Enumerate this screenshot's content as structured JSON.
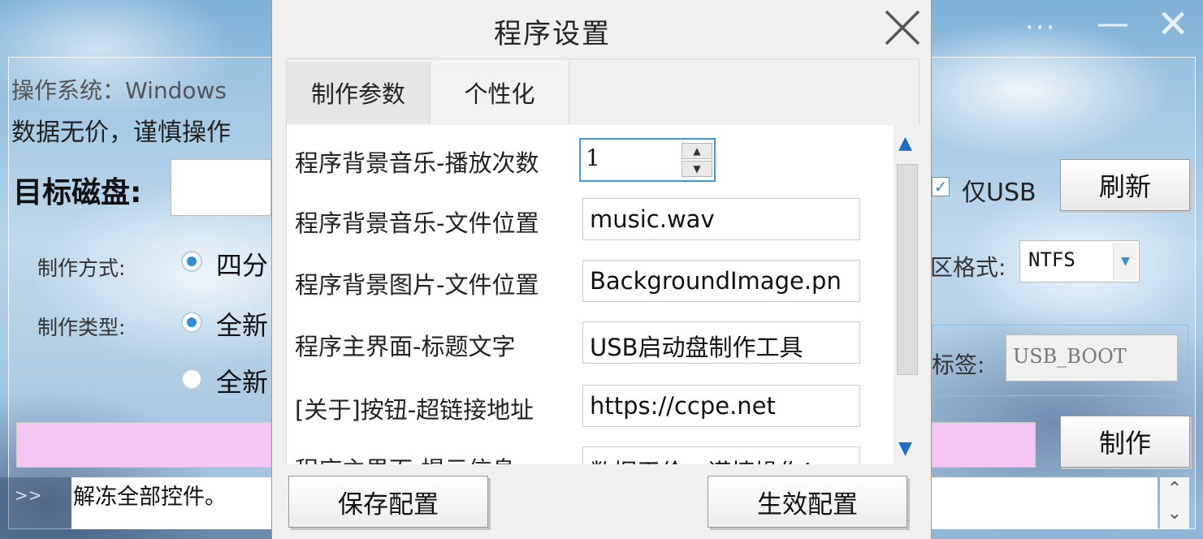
{
  "colors": {
    "accent": "#2e8fd6",
    "progress": "#f5c6f4",
    "focus_border": "#3a9ae8",
    "scroll_arrow": "#1e6fc7"
  },
  "main_window": {
    "os_label": "操作系统：Windows",
    "warning_text": "数据无价，谨慎操作",
    "target_disk_label": "目标磁盘:",
    "make_method_label": "制作方式:",
    "make_method_option": "四分",
    "make_type_label": "制作类型:",
    "make_type_option_1": "全新",
    "make_type_option_2": "全新",
    "usb_only_label": "仅USB",
    "refresh_button": "刷新",
    "format_label": "区格式:",
    "format_value": "NTFS",
    "volume_label_label": "标签:",
    "volume_label_value": "USB_BOOT",
    "make_button": "制作",
    "log_prompt": ">>",
    "log_text": "解冻全部控件。"
  },
  "dialog": {
    "title": "程序设置",
    "tabs": [
      {
        "label": "制作参数"
      },
      {
        "label": "个性化"
      }
    ],
    "settings": [
      {
        "label": "程序背景音乐-播放次数",
        "value": "1"
      },
      {
        "label": "程序背景音乐-文件位置",
        "value": "music.wav"
      },
      {
        "label": "程序背景图片-文件位置",
        "value": "BackgroundImage.pn"
      },
      {
        "label": "程序主界面-标题文字",
        "value": "USB启动盘制作工具"
      },
      {
        "label": "[关于]按钮-超链接地址",
        "value": "https://ccpe.net"
      },
      {
        "label": "程序主界面-提示信息",
        "value": "数据无价，谨慎操作！"
      }
    ],
    "save_button": "保存配置",
    "apply_button": "生效配置"
  }
}
